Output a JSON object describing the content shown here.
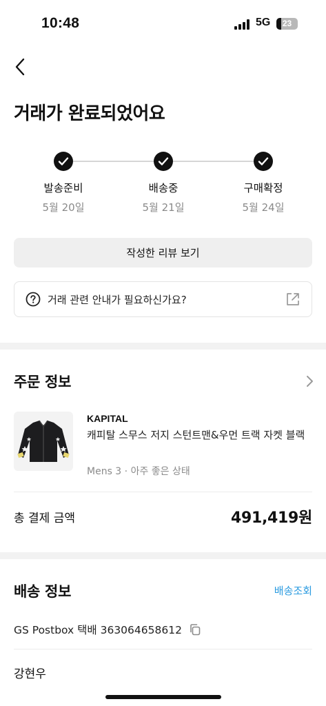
{
  "status_bar": {
    "time": "10:48",
    "network": "5G",
    "battery": "23",
    "battery_level": 0.23,
    "icons": [
      "signal-icon",
      "battery-icon"
    ]
  },
  "header": {
    "back_icon": "chevron-left-icon",
    "title": "거래가 완료되었어요"
  },
  "progress": {
    "steps": [
      {
        "label": "발송준비",
        "date": "5월 20일",
        "completed": true
      },
      {
        "label": "배송중",
        "date": "5월 21일",
        "completed": true
      },
      {
        "label": "구매확정",
        "date": "5월 24일",
        "completed": true
      }
    ]
  },
  "review_button": {
    "label": "작성한 리뷰 보기"
  },
  "guide": {
    "text": "거래 관련 안내가 필요하신가요?",
    "left_icon": "question-circle-icon",
    "right_icon": "external-link-icon"
  },
  "order_info": {
    "title": "주문 정보",
    "chevron_icon": "chevron-right-icon",
    "product": {
      "brand": "KAPITAL",
      "name": "캐피탈 스무스 저지 스턴트맨&우먼 트랙 자켓 블랙",
      "option": "Mens 3 · 아주 좋은 상태"
    },
    "total_label": "총 결제 금액",
    "total_amount": "491,419원"
  },
  "shipping_info": {
    "title": "배송 정보",
    "tracking_link": "배송조회",
    "carrier": "GS Postbox 택배 363064658612",
    "copy_icon": "copy-icon",
    "recipient": "강현우"
  },
  "colors": {
    "accent_link": "#2b9be0",
    "primary_text": "#111111",
    "secondary_text": "#8a8a8a",
    "section_divider": "#f2f2f2"
  }
}
